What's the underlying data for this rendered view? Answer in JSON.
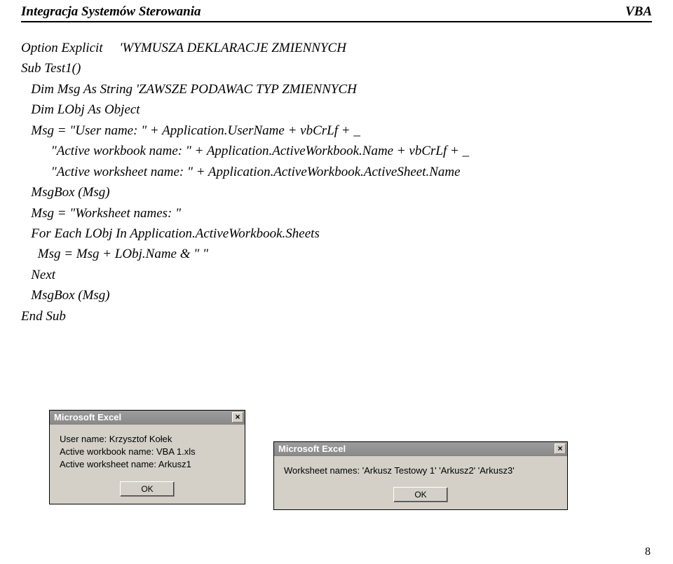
{
  "header": {
    "left": "Integracja Systemów Sterowania",
    "right": "VBA"
  },
  "code": {
    "l01a": "Option Explicit     ",
    "l01b": "'WYMUSZA DEKLARACJE ZMIENNYCH",
    "l02": "",
    "l03": "Sub Test1()",
    "l04a": "   Dim Msg As String",
    "l04b": " 'ZAWSZE PODAWAC TYP ZMIENNYCH",
    "l05": "   Dim LObj As Object",
    "l06": "   Msg = \"User name: \" + Application.UserName + vbCrLf + _",
    "l07": "         \"Active workbook name: \" + Application.ActiveWorkbook.Name + vbCrLf + _",
    "l08": "         \"Active worksheet name: \" + Application.ActiveWorkbook.ActiveSheet.Name",
    "l09": "   MsgBox (Msg)",
    "l10": "   Msg = \"Worksheet names: \"",
    "l11": "   For Each LObj In Application.ActiveWorkbook.Sheets",
    "l12": "     Msg = Msg + LObj.Name & \" \"",
    "l13": "   Next",
    "l14": "   MsgBox (Msg)",
    "l15": "End Sub"
  },
  "msgbox1": {
    "title": "Microsoft Excel",
    "line1": "User name: Krzysztof Kołek",
    "line2": "Active workbook name: VBA 1.xls",
    "line3": "Active worksheet name: Arkusz1",
    "ok": "OK"
  },
  "msgbox2": {
    "title": "Microsoft Excel",
    "text": "Worksheet names: 'Arkusz Testowy 1' 'Arkusz2' 'Arkusz3'",
    "ok": "OK"
  },
  "page_num": "8"
}
